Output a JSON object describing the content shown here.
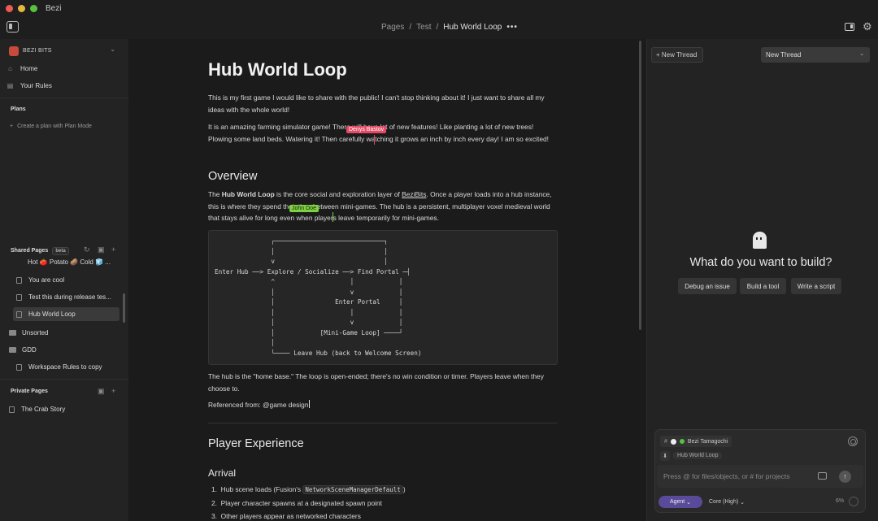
{
  "app": {
    "title": "Bezi"
  },
  "breadcrumb": {
    "items": [
      "Pages",
      "Test",
      "Hub World Loop"
    ],
    "separator": "/",
    "more": "•••"
  },
  "sidebar": {
    "workspace": "BEZI BITS",
    "nav": [
      {
        "label": "Home",
        "icon": "home-icon"
      },
      {
        "label": "Your Rules",
        "icon": "rules-icon"
      }
    ],
    "plans_title": "Plans",
    "plans_create": "Create a plan with Plan Mode",
    "shared_title": "Shared Pages",
    "shared_badge": "beta",
    "shared_pages": [
      {
        "label": "Hot 🍅 Potato 🥔 Cold 🧊 ..."
      },
      {
        "label": "You are cool"
      },
      {
        "label": "Test this during release tes..."
      },
      {
        "label": "Hub World Loop",
        "active": true
      }
    ],
    "folders": [
      {
        "label": "Unsorted"
      },
      {
        "label": "GDD"
      }
    ],
    "gdd_child": "Workspace Rules to copy",
    "private_title": "Private Pages",
    "private_pages": [
      {
        "label": "The Crab Story"
      }
    ]
  },
  "doc": {
    "title": "Hub World Loop",
    "intro": "This is my first game I would like to share with the public! I can't stop thinking about it! I just want to share all my ideas with the whole world!",
    "farming_pre": "It is an amazing farming simulator game! Th",
    "farming_mid": "ere will have",
    "farming_post": " lot of new features! Like planting a lot of new trees! Plowing some land beds. Watering it! Then carefully",
    "farming_end": " watching it grows an inch by inch every day! I am so excited!",
    "cursor_red": "Denys Bastov",
    "cursor_green": "John Doe",
    "overview_heading": "Overview",
    "overview_1": "The ",
    "overview_bold": "Hub World Loop",
    "overview_2": " is the core social and exploration layer of ",
    "overview_link": "BeziBits",
    "overview_3": ". Once a player loads into a hub instance, this is where th",
    "overview_4": "ey spend their time between mini-games. The hub is a persistent, multiplayer voxel medieval world that stays alive for long",
    "overview_5": " even when players leave temporarily for mini-games.",
    "diagram": "               ┌─────────────────────────────┐\n               │                             │\n               v                             │\nEnter Hub ──> Explore / Socialize ──> Find Portal ─┤\n               ^                    │            │\n               │                    v            │\n               │                Enter Portal     │\n               │                    │            │\n               │                    v            │\n               │            [Mini-Game Loop] ────┘\n               │                                  \n               └──── Leave Hub (back to Welcome Screen)",
    "hub_para": "The hub is the \"home base.\" The loop is open-ended; there's no win condition or timer. Players leave when they choose to.",
    "referenced": "Referenced from: @game design",
    "player_exp_heading": "Player Experience",
    "arrival_heading": "Arrival",
    "arrival_items": [
      {
        "num": "1.",
        "pre": "Hub scene loads (Fusion's ",
        "code": "NetworkSceneManagerDefault",
        "post": ")"
      },
      {
        "num": "2.",
        "pre": "Player character spawns at a designated spawn point",
        "code": "",
        "post": ""
      },
      {
        "num": "3.",
        "pre": "Other players appear as networked characters",
        "code": "",
        "post": ""
      }
    ]
  },
  "assistant": {
    "new_thread_button": "+ New Thread",
    "thread_select": "New Thread",
    "empty_title": "What do you want to build?",
    "suggestions": [
      "Debug an issue",
      "Build a tool",
      "Write a script"
    ],
    "context_chip": "Bezi Tamagochi",
    "file_chip": "Hub World Loop",
    "input_placeholder": "Press @ for files/objects, or # for projects",
    "mode": "Agent",
    "model": "Core (High)",
    "context_pct": "6%"
  }
}
